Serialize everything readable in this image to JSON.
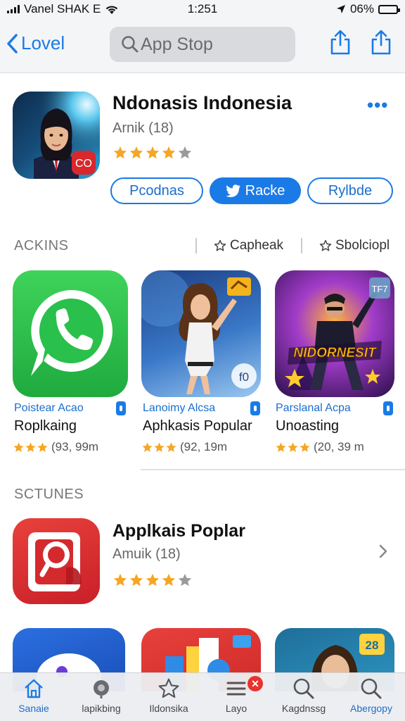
{
  "status_bar": {
    "carrier": "Vanel SHAK E",
    "time": "1:251",
    "battery": "06%",
    "battery_level": 0.06
  },
  "nav": {
    "back_label": "Lovel",
    "search_placeholder": "App Stop"
  },
  "hero_app": {
    "title": "Ndonasis Indonesia",
    "subtitle": "Arnik (18)",
    "rating_stars": 4,
    "buttons": [
      "Pcodnas",
      "Racke",
      "Rylbde"
    ]
  },
  "section1": {
    "title": "ACKINS",
    "link1": "Capheak",
    "link2": "Sbolciopl"
  },
  "apps": [
    {
      "category": "Poistear Acao",
      "name": "Roplkaing",
      "rating": "(93, 99m",
      "stars": 3
    },
    {
      "category": "Lanoimy Alcsa",
      "name": "Aphkasis Popular",
      "rating": "(92, 19m",
      "stars": 3
    },
    {
      "category": "Parslanal Acpa",
      "name": "Unoasting",
      "rating": "(20, 39 m",
      "stars": 3
    }
  ],
  "app_icon_text": {
    "badge_hero": "CO",
    "badge_app2": "f0",
    "badge_app3": "TF7",
    "game_title": "NIDORNESIT"
  },
  "section2": {
    "title": "SCTUNES"
  },
  "featured_app": {
    "title": "Applkais Poplar",
    "subtitle": "Amuik (18)",
    "rating_stars": 4
  },
  "peek_badge": "28",
  "tabs": [
    {
      "label": "Sanaie",
      "icon": "home-icon"
    },
    {
      "label": "lapikbing",
      "icon": "apps-icon"
    },
    {
      "label": "Ildonsika",
      "icon": "star-icon"
    },
    {
      "label": "Layo",
      "icon": "list-icon",
      "badge": "✕"
    },
    {
      "label": "Kagdnssg",
      "icon": "search-icon"
    },
    {
      "label": "Abergopy",
      "icon": "search-icon"
    }
  ],
  "colors": {
    "accent": "#1a7be6",
    "star": "#f5a623",
    "star_empty": "#9a9a9a"
  }
}
